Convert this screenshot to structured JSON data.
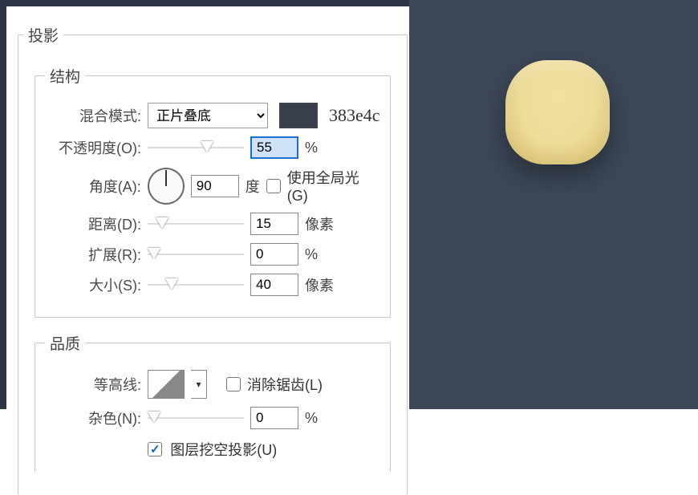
{
  "effect_title": "投影",
  "structure": {
    "legend": "结构",
    "blend_mode": {
      "label": "混合模式:",
      "value": "正片叠底"
    },
    "color_hex": "383e4c",
    "opacity": {
      "label": "不透明度(O):",
      "value": "55",
      "unit": "%",
      "pct": 55
    },
    "angle": {
      "label": "角度(A):",
      "value": "90",
      "unit": "度",
      "global_label": "使用全局光(G)",
      "use_global": false
    },
    "distance": {
      "label": "距离(D):",
      "value": "15",
      "unit": "像素",
      "pct": 8
    },
    "spread": {
      "label": "扩展(R):",
      "value": "0",
      "unit": "%",
      "pct": 0
    },
    "size": {
      "label": "大小(S):",
      "value": "40",
      "unit": "像素",
      "pct": 18
    }
  },
  "quality": {
    "legend": "品质",
    "contour": {
      "label": "等高线:",
      "antialias_label": "消除锯齿(L)",
      "antialias": false
    },
    "noise": {
      "label": "杂色(N):",
      "value": "0",
      "unit": "%",
      "pct": 0
    }
  },
  "footer": {
    "knockout_label": "图层挖空投影(U)",
    "knockout": true
  }
}
